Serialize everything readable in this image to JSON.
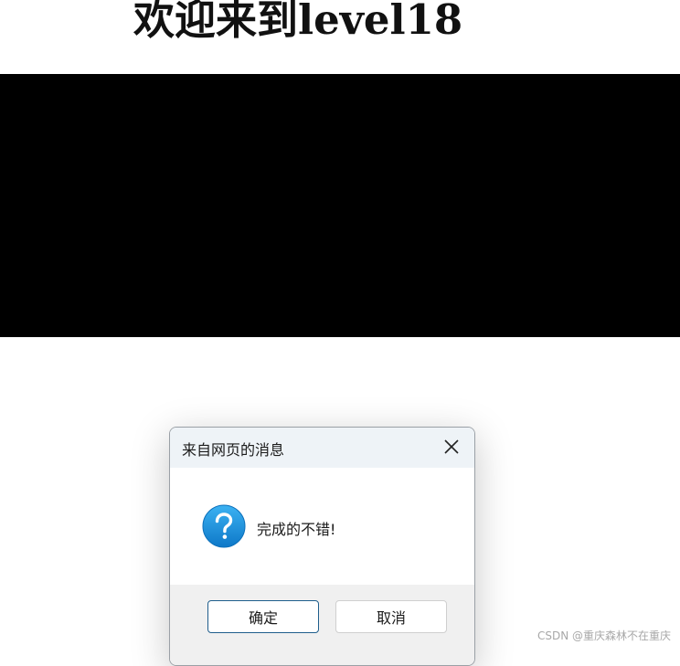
{
  "page": {
    "heading_prefix": "欢迎来到",
    "heading_suffix": "level18"
  },
  "dialog": {
    "title": "来自网页的消息",
    "message": "完成的不错!",
    "icon": "question-icon",
    "ok_label": "确定",
    "cancel_label": "取消"
  },
  "watermark": "CSDN @重庆森林不在重庆",
  "colors": {
    "media_block": "#000000",
    "titlebar": "#eef3f7",
    "footer": "#f0f0f0",
    "ok_border": "#1f5e8c",
    "icon_blue": "#1c8fe0"
  }
}
